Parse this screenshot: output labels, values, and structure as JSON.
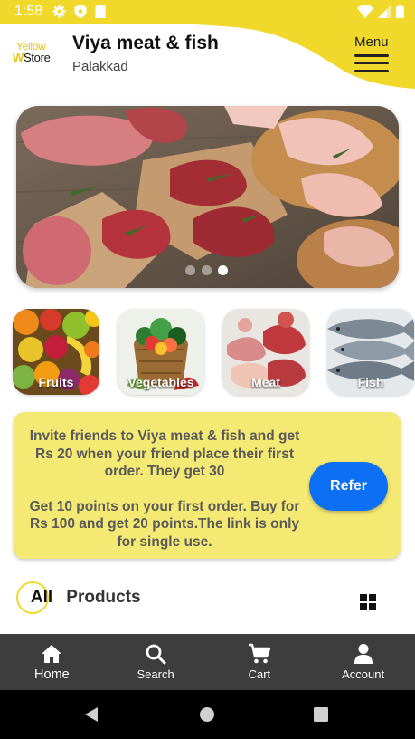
{
  "status_bar": {
    "time": "1:58",
    "background_color": "#f0d92a",
    "left_icons": [
      "gear-icon",
      "shield-icon",
      "sd-card-icon"
    ],
    "right_icons": [
      "wifi-icon",
      "signal-icon",
      "battery-icon"
    ]
  },
  "header": {
    "logo_top": "Yellow",
    "logo_bottom": "Store",
    "store_name": "Viya meat & fish",
    "location": "Palakkad",
    "menu_label": "Menu"
  },
  "banner": {
    "slide_count": 3,
    "active_slide": 3
  },
  "categories": [
    {
      "label": "Fruits"
    },
    {
      "label": "Vegetables"
    },
    {
      "label": "Meat"
    },
    {
      "label": "Fish"
    }
  ],
  "referral": {
    "line1": "Invite friends to Viya meat & fish and get Rs 20 when your friend place their first order. They get 30",
    "line2": "Get 10 points on your first order. Buy for Rs 100 and get 20 points.The link is only for single use.",
    "button_label": "Refer",
    "card_color": "#f4e972",
    "button_color": "#0d6ff3"
  },
  "products": {
    "heading_all": "All",
    "heading_rest": " Products",
    "view_icon": "grid-icon"
  },
  "bottom_nav": [
    {
      "label": "Home",
      "icon": "home-icon",
      "active": true
    },
    {
      "label": "Search",
      "icon": "search-icon",
      "active": false
    },
    {
      "label": "Cart",
      "icon": "cart-icon",
      "active": false
    },
    {
      "label": "Account",
      "icon": "account-icon",
      "active": false
    }
  ]
}
